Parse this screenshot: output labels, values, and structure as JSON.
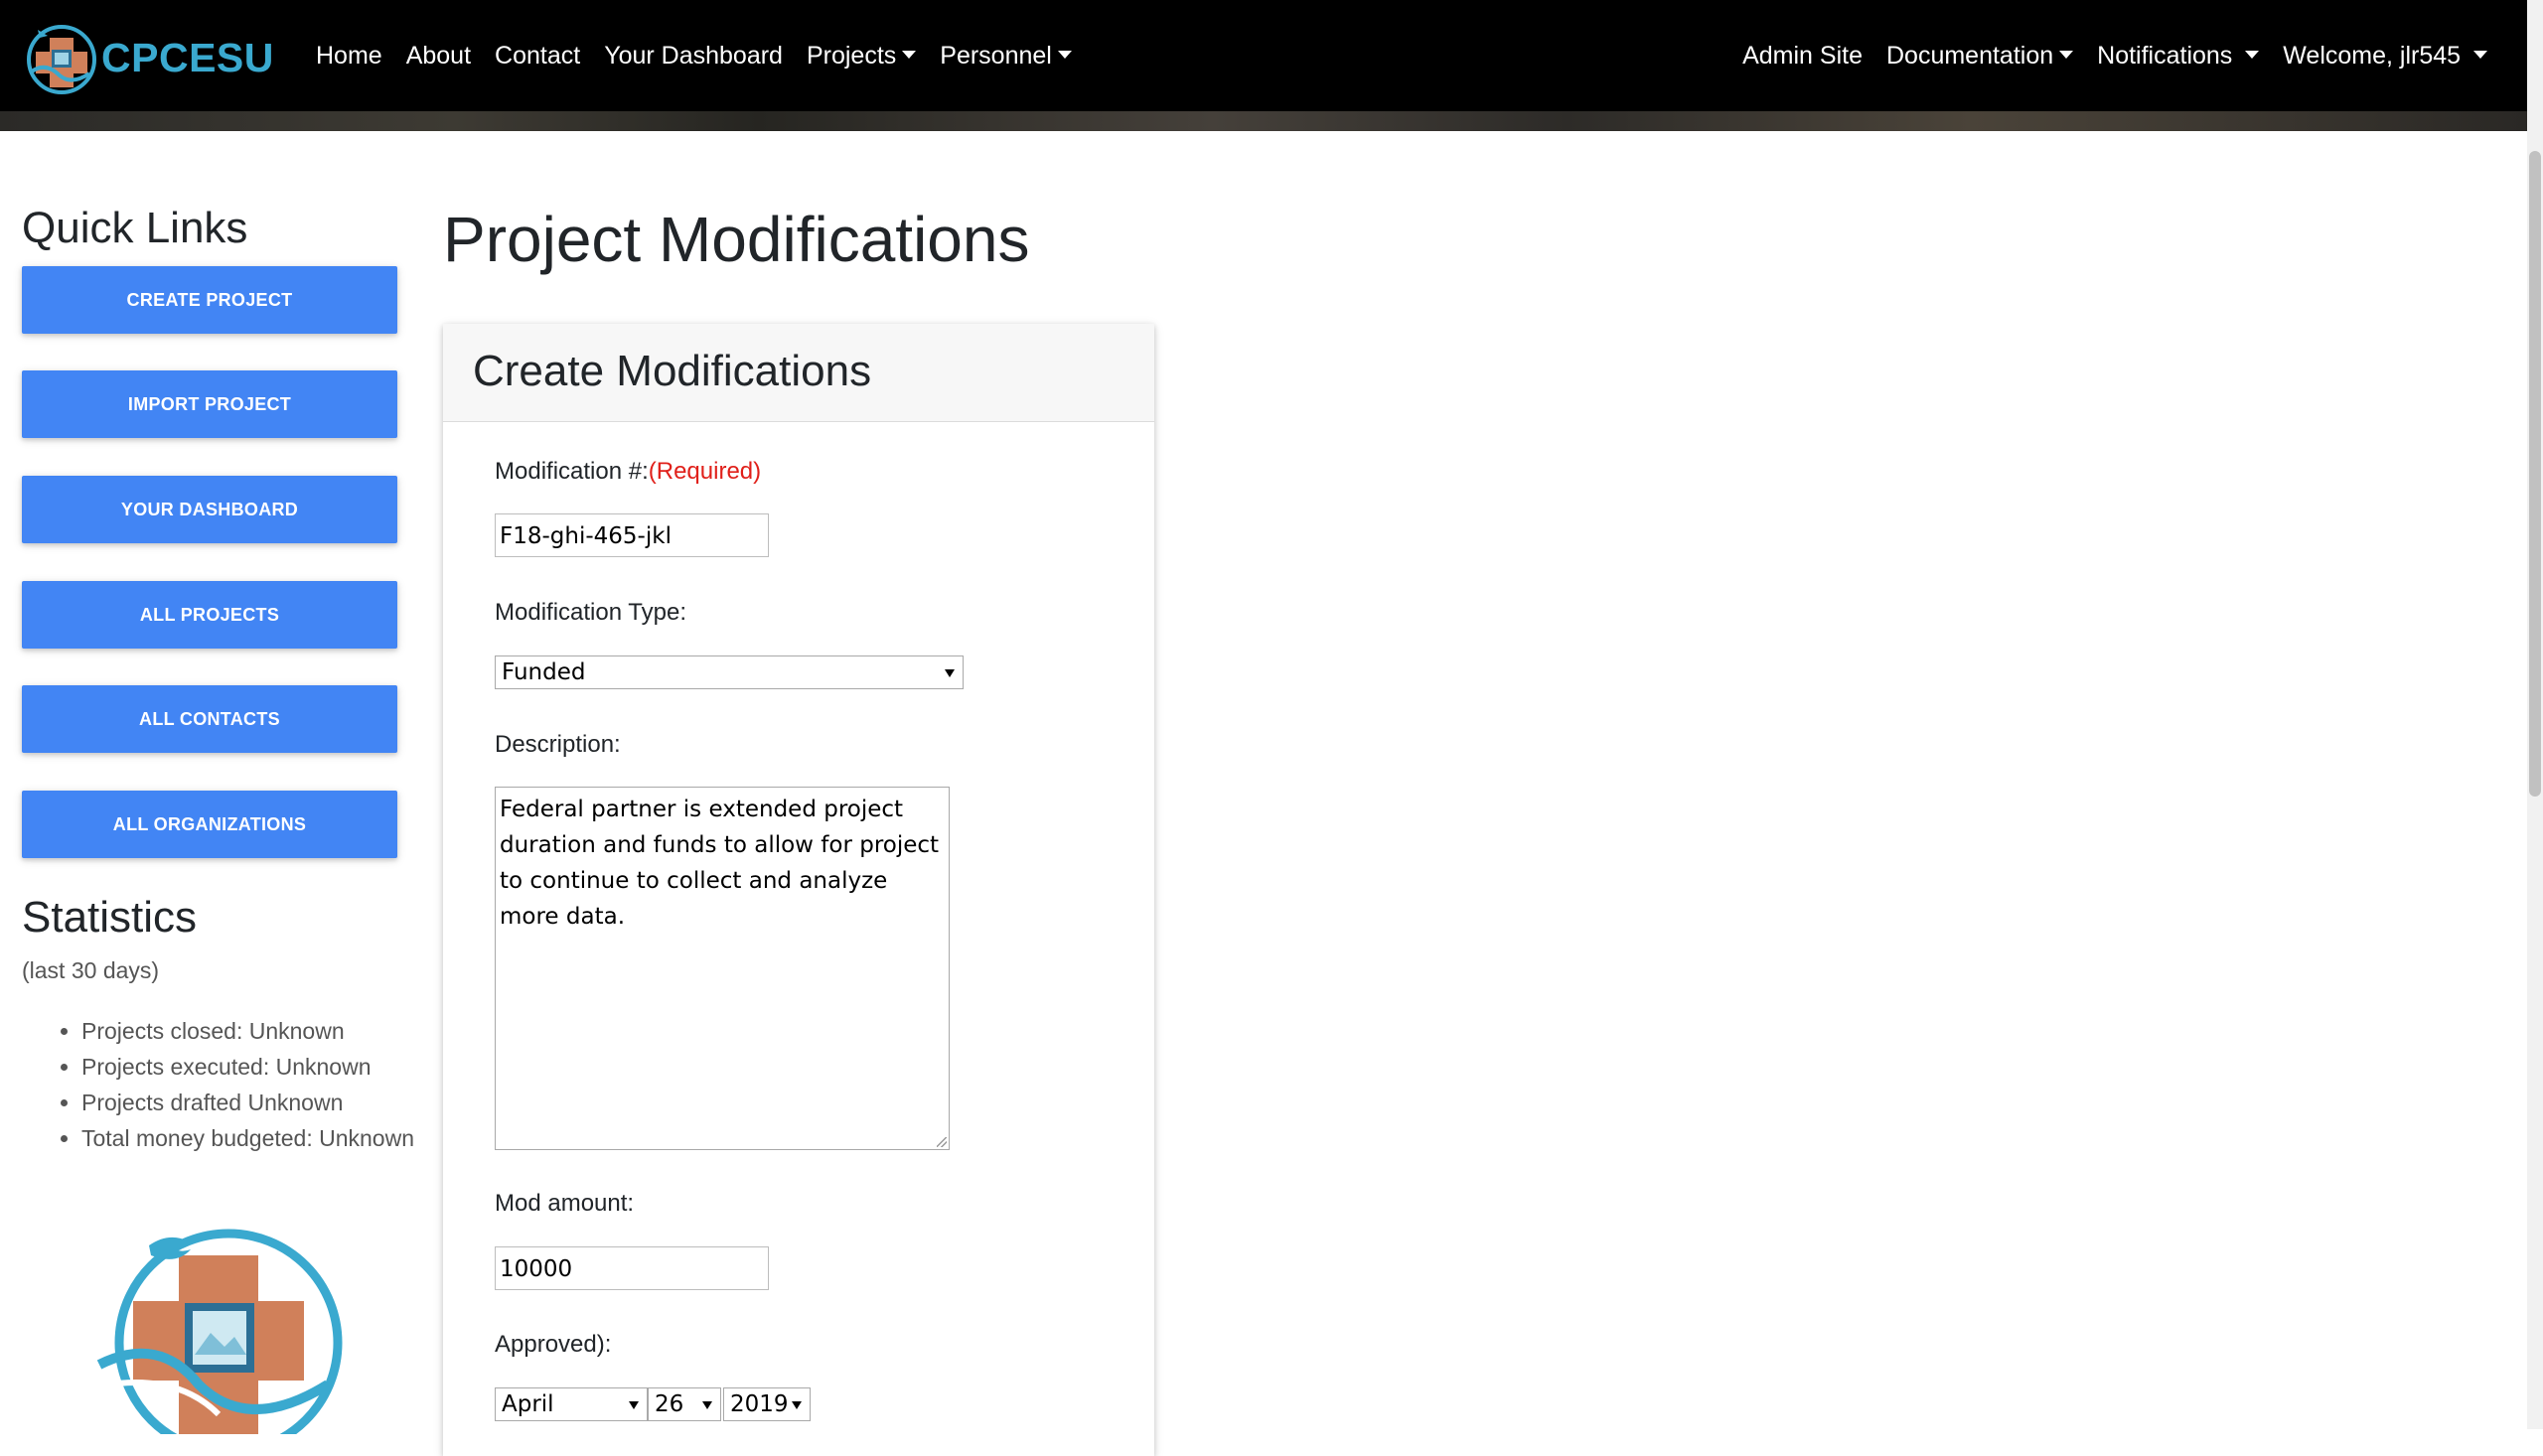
{
  "navbar": {
    "brand": "CPCESU",
    "left_links": [
      {
        "label": "Home"
      },
      {
        "label": "About"
      },
      {
        "label": "Contact"
      },
      {
        "label": "Your Dashboard"
      },
      {
        "label": "Projects",
        "dropdown": true
      },
      {
        "label": "Personnel",
        "dropdown": true
      }
    ],
    "right_links": [
      {
        "label": "Admin Site"
      },
      {
        "label": "Documentation",
        "dropdown": true
      },
      {
        "label": "Notifications",
        "dropdown": true
      },
      {
        "label": "Welcome, jlr545",
        "dropdown": true
      }
    ]
  },
  "sidebar": {
    "title": "Quick Links",
    "buttons": [
      "Create Project",
      "Import Project",
      "Your Dashboard",
      "All Projects",
      "All Contacts",
      "All Organizations"
    ],
    "stats_title": "Statistics",
    "stats_subtitle": "(last 30 days)",
    "stats": [
      "Projects closed: Unknown",
      "Projects executed: Unknown",
      "Projects drafted Unknown",
      "Total money budgeted: Unknown"
    ]
  },
  "main": {
    "page_title": "Project Modifications",
    "card_title": "Create Modifications",
    "form": {
      "mod_number_label": "Modification #:",
      "required_label": "(Required)",
      "mod_number_value": "F18-ghi-465-jkl",
      "mod_type_label": "Modification Type:",
      "mod_type_value": "Funded",
      "description_label": "Description:",
      "description_value": "Federal partner is extended project duration and funds to allow for project to continue to collect and analyze more data.",
      "mod_amount_label": "Mod amount:",
      "mod_amount_value": "10000",
      "approved_label": "Approved):",
      "approved_month": "April",
      "approved_day": "26",
      "approved_year": "2019"
    }
  },
  "colors": {
    "navbar_bg": "#000000",
    "brand_accent": "#3aa9cf",
    "button_primary": "#4285f4",
    "required_text": "#e0201a"
  }
}
